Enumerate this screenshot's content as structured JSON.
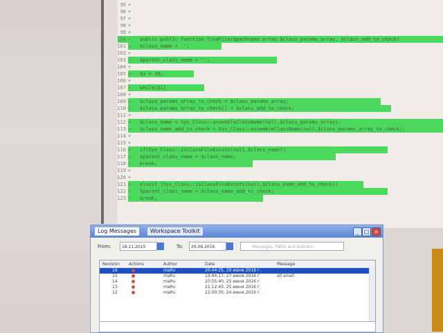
{
  "editor": {
    "lines": [
      {
        "num": "95",
        "code": ""
      },
      {
        "num": "96",
        "code": ""
      },
      {
        "num": "97",
        "code": ""
      },
      {
        "num": "98",
        "code": ""
      },
      {
        "num": "99",
        "code": ""
      },
      {
        "num": "100",
        "code": "public public function findFile($pathname array $class_params_array, $class_add_to_check)"
      },
      {
        "num": "101",
        "code": "    $class_name = '';"
      },
      {
        "num": "102",
        "code": ""
      },
      {
        "num": "103",
        "code": "    $parent_class_name = '';"
      },
      {
        "num": "104",
        "code": ""
      },
      {
        "num": "105",
        "code": "    $i = 10;"
      },
      {
        "num": "106",
        "code": ""
      },
      {
        "num": "107",
        "code": "    while($i)"
      },
      {
        "num": "108",
        "code": ""
      },
      {
        "num": "109",
        "code": "        $class_params_array_to_check = $class_params_array;"
      },
      {
        "num": "110",
        "code": "        $class_params_array_to_check[] = $class_add_to_check;"
      },
      {
        "num": "111",
        "code": ""
      },
      {
        "num": "112",
        "code": "        $class_name = Sys_Class::assembleClassName(null,$class_params_array);"
      },
      {
        "num": "113",
        "code": "        $class_name_add_to_check = Sys_Class::assembleClassName(null,$class_params_array_to_check);"
      },
      {
        "num": "114",
        "code": ""
      },
      {
        "num": "115",
        "code": ""
      },
      {
        "num": "116",
        "code": "        if(Sys_Class::isClassFileExists(null,$class_name))"
      },
      {
        "num": "117",
        "code": "            $parent_class_name = $class_name;"
      },
      {
        "num": "118",
        "code": "            break;"
      },
      {
        "num": "119",
        "code": ""
      },
      {
        "num": "120",
        "code": ""
      },
      {
        "num": "121",
        "code": "        elseif (Sys_Class::isClassFileExists(null,$class_name_add_to_check))"
      },
      {
        "num": "122",
        "code": "            $parent_class_name = $class_name_add_to_check;"
      },
      {
        "num": "123",
        "code": "            break;"
      }
    ]
  },
  "dialog": {
    "tab1": "Log Messages",
    "tab2": "Workspace Toolkit",
    "filters": {
      "from_label": "From:",
      "from_value": "18.11.2015",
      "to_label": "To:",
      "to_value": "26.06.2016",
      "search_placeholder": "Messages, Paths and Authors"
    },
    "table": {
      "headers": [
        "Revision",
        "Actions",
        "Author",
        "Date",
        "Message"
      ],
      "rows": [
        {
          "rev": "16",
          "actions": "",
          "author": "maRv",
          "date": "20:44:25, 29 июня 2016 г.",
          "message": ""
        },
        {
          "rev": "15",
          "actions": "",
          "author": "maRv",
          "date": "19:44:17, 27 июня 2016 г.",
          "message": "all small"
        },
        {
          "rev": "14",
          "actions": "",
          "author": "maRv",
          "date": "20:55:40, 25 июня 2016 г.",
          "message": ""
        },
        {
          "rev": "13",
          "actions": "",
          "author": "maRv",
          "date": "21:12:45, 25 июня 2016 г.",
          "message": ""
        },
        {
          "rev": "12",
          "actions": "",
          "author": "maRv",
          "date": "22:00:35, 24 июня 2016 г.",
          "message": ""
        }
      ]
    }
  }
}
